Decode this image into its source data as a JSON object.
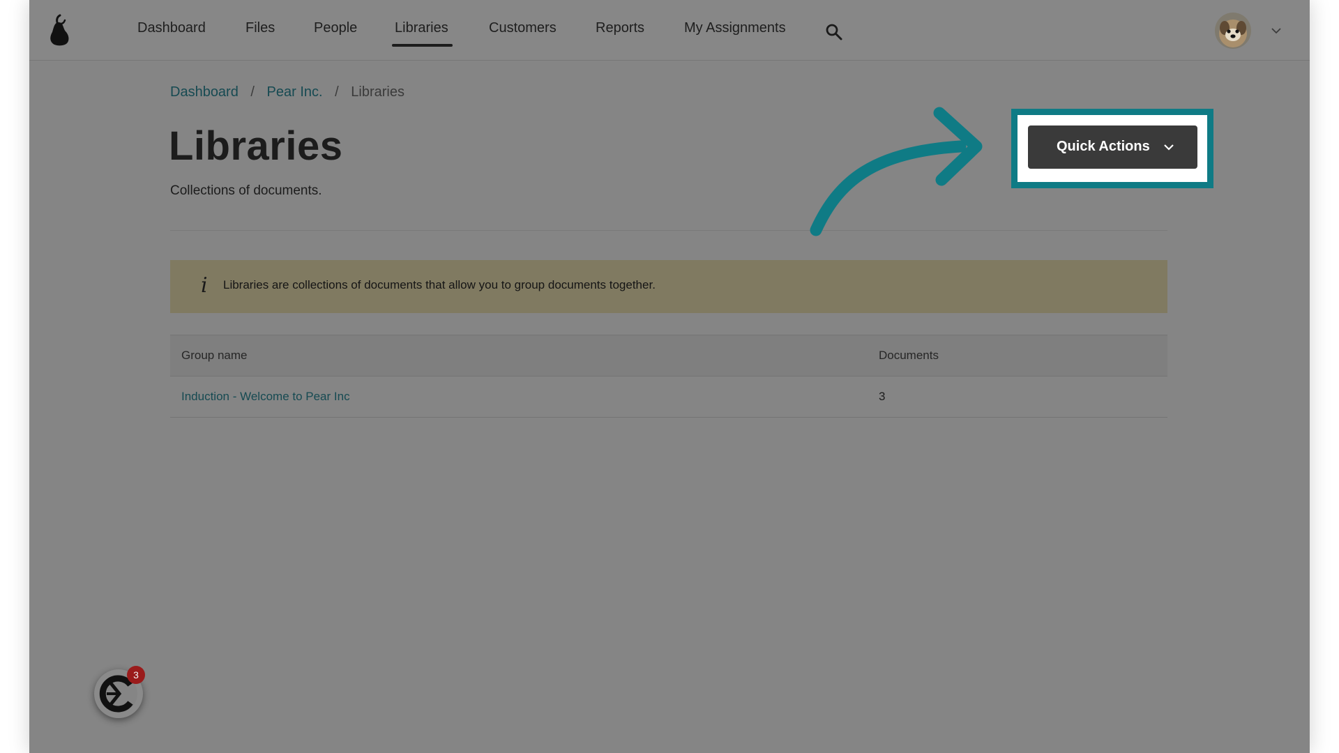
{
  "nav": {
    "items": [
      {
        "label": "Dashboard"
      },
      {
        "label": "Files"
      },
      {
        "label": "People"
      },
      {
        "label": "Libraries",
        "active": true
      },
      {
        "label": "Customers"
      },
      {
        "label": "Reports"
      },
      {
        "label": "My Assignments"
      }
    ],
    "search_icon": "search-icon",
    "account_icon": "chevron-down-icon"
  },
  "breadcrumb": {
    "items": [
      "Dashboard",
      "Pear Inc.",
      "Libraries"
    ],
    "separator": "/"
  },
  "header": {
    "title": "Libraries",
    "subtitle": "Collections of documents."
  },
  "quick_actions": {
    "label": "Quick Actions",
    "icon": "chevron-down-icon"
  },
  "info_banner": {
    "icon": "i",
    "text": "Libraries are collections of documents that allow you to group documents together."
  },
  "table": {
    "columns": [
      "Group name",
      "Documents"
    ],
    "rows": [
      {
        "name": "Induction - Welcome to Pear Inc",
        "documents": "3"
      }
    ]
  },
  "widget": {
    "badge": "3"
  },
  "colors": {
    "accent": "#0f7b85",
    "link": "#164a52",
    "banner": "#807a61",
    "badge": "#9a1b1b"
  }
}
